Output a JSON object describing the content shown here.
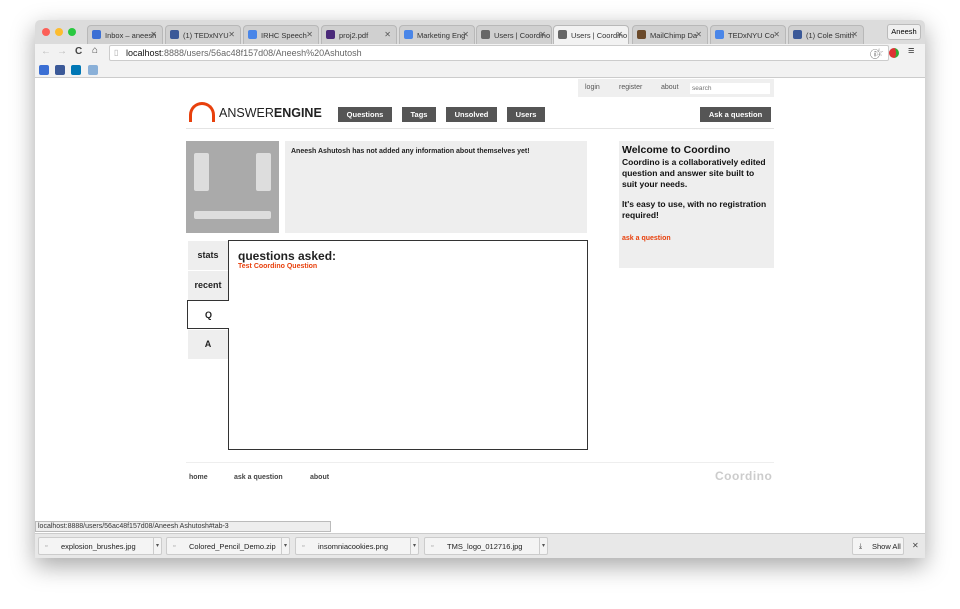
{
  "browser": {
    "tabs": [
      {
        "title": "Inbox – aneesh",
        "color": "#3b6fd4"
      },
      {
        "title": "(1) TEDxNYU",
        "color": "#3b5998"
      },
      {
        "title": "IRHC Speech",
        "color": "#4a86e8"
      },
      {
        "title": "proj2.pdf",
        "color": "#4b2a7a"
      },
      {
        "title": "Marketing Eng",
        "color": "#4a86e8"
      },
      {
        "title": "Users | Coordino",
        "color": "#666666"
      },
      {
        "title": "Users | Coordino",
        "color": "#666666"
      },
      {
        "title": "MailChimp Da",
        "color": "#6b4a2a"
      },
      {
        "title": "TEDxNYU Co",
        "color": "#4a86e8"
      },
      {
        "title": "(1) Cole Smith",
        "color": "#3b5998"
      }
    ],
    "active_tab": 6,
    "profile": "Aneesh",
    "url_host": "localhost",
    "url_rest": ":8888/users/56ac48f157d08/Aneesh%20Ashutosh",
    "status_url": "localhost:8888/users/56ac48f157d08/Aneesh Ashutosh#tab-3",
    "downloads": [
      "explosion_brushes.jpg",
      "Colored_Pencil_Demo.zip",
      "insomniacookies.png",
      "TMS_logo_012716.jpg"
    ],
    "show_all": "Show All"
  },
  "topbar": {
    "login": "login",
    "register": "register",
    "about": "about",
    "search_placeholder": "search"
  },
  "header": {
    "logo_a": "ANSWER",
    "logo_b": "ENGINE",
    "nav": [
      "Questions",
      "Tags",
      "Unsolved",
      "Users"
    ],
    "ask": "Ask a question"
  },
  "profile": {
    "about": "Aneesh Ashutosh has not added any information about themselves yet!"
  },
  "tabs": [
    "stats",
    "recent",
    "Q",
    "A"
  ],
  "content": {
    "heading": "questions asked:",
    "questions": [
      "Test Coordino Question"
    ]
  },
  "sidebar": {
    "title": "Welcome to Coordino",
    "p1": "Coordino is a collaboratively edited question and answer site built to suit your needs.",
    "p2": "It's easy to use, with no registration required!",
    "link": "ask a question"
  },
  "footer": {
    "links": [
      "home",
      "ask a question",
      "about"
    ],
    "logo": "Coordino"
  },
  "colors": {
    "accent": "#e8400c",
    "button": "#555555"
  }
}
